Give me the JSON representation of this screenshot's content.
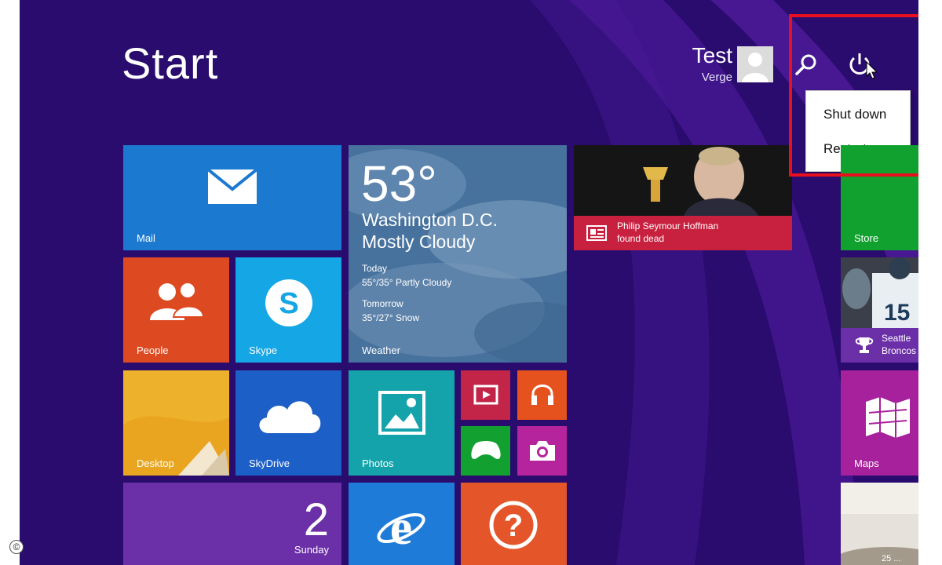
{
  "start": {
    "title": "Start"
  },
  "user": {
    "name": "Test",
    "subtitle": "Verge"
  },
  "power_menu": {
    "shutdown": "Shut down",
    "restart": "Restart"
  },
  "tiles": {
    "mail": {
      "label": "Mail",
      "icon": "envelope-icon",
      "color": "#1b7ad0"
    },
    "weather": {
      "label": "Weather",
      "temp": "53°",
      "city": "Washington D.C.",
      "condition": "Mostly Cloudy",
      "today_label": "Today",
      "today_forecast": "55°/35° Partly Cloudy",
      "tomorrow_label": "Tomorrow",
      "tomorrow_forecast": "35°/27° Snow"
    },
    "news": {
      "headline_line1": "Philip Seymour Hoffman",
      "headline_line2": "found dead",
      "icon": "news-icon"
    },
    "store": {
      "label": "Store",
      "color": "#10a12e"
    },
    "people": {
      "label": "People",
      "icon": "people-icon",
      "color": "#dd4a22"
    },
    "skype": {
      "label": "Skype",
      "icon": "skype-icon",
      "color": "#14a6e5"
    },
    "sports": {
      "line1": "Seattle",
      "line2": "Broncos",
      "icon": "trophy-icon"
    },
    "desktop": {
      "label": "Desktop",
      "color": "#e8a021"
    },
    "skydrive": {
      "label": "SkyDrive",
      "icon": "cloud-icon",
      "color": "#1c5fc7"
    },
    "photos": {
      "label": "Photos",
      "icon": "photo-icon",
      "color": "#15a3ab"
    },
    "video": {
      "icon": "video-icon"
    },
    "music": {
      "icon": "headphones-icon"
    },
    "games": {
      "icon": "xbox-controller-icon"
    },
    "camera": {
      "icon": "camera-icon"
    },
    "maps": {
      "label": "Maps",
      "icon": "map-icon",
      "color": "#a7209c"
    },
    "calendar": {
      "day": "2",
      "weekday": "Sunday"
    },
    "ie": {
      "icon": "internet-explorer-icon"
    },
    "help": {
      "icon": "help-icon"
    },
    "food": {
      "price": "25 ..."
    }
  },
  "colors": {
    "background": "#2a0b6e",
    "highlight": "#e8101e"
  },
  "copyright": "©"
}
